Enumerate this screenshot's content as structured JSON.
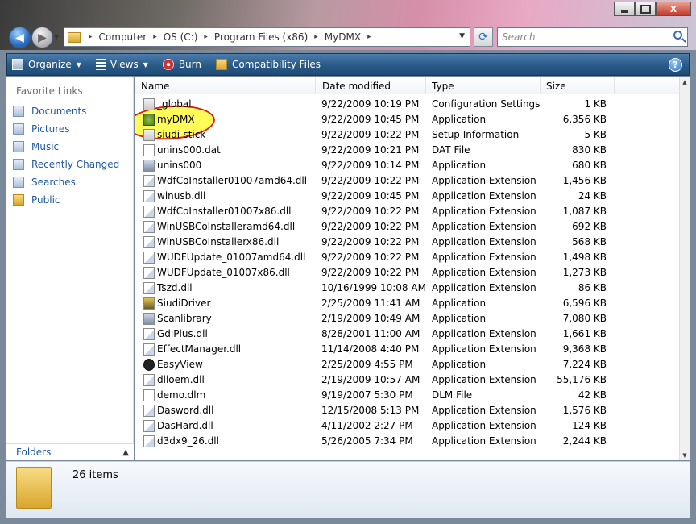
{
  "window": {
    "close_glyph": "X"
  },
  "address_bar": {
    "crumbs": [
      "Computer",
      "OS (C:)",
      "Program Files (x86)",
      "MyDMX"
    ]
  },
  "search": {
    "placeholder": "Search"
  },
  "toolbar": {
    "organize": "Organize",
    "views": "Views",
    "burn": "Burn",
    "compatibility": "Compatibility Files",
    "help": "?"
  },
  "nav_pane": {
    "title": "Favorite Links",
    "items": [
      "Documents",
      "Pictures",
      "Music",
      "Recently Changed",
      "Searches",
      "Public"
    ],
    "folders_label": "Folders"
  },
  "file_list": {
    "columns": [
      "Name",
      "Date modified",
      "Type",
      "Size"
    ],
    "rows": [
      {
        "name": "_global",
        "date": "9/22/2009 10:19 PM",
        "type": "Configuration Settings",
        "size": "1 KB",
        "icon": "settings-file-icon"
      },
      {
        "name": "myDMX",
        "date": "9/22/2009 10:45 PM",
        "type": "Application",
        "size": "6,356 KB",
        "icon": "mydmx-app-icon"
      },
      {
        "name": "siudi-stick",
        "date": "9/22/2009 10:22 PM",
        "type": "Setup Information",
        "size": "5 KB",
        "icon": "setup-info-icon"
      },
      {
        "name": "unins000.dat",
        "date": "9/22/2009 10:21 PM",
        "type": "DAT File",
        "size": "830 KB",
        "icon": "file-icon"
      },
      {
        "name": "unins000",
        "date": "9/22/2009 10:14 PM",
        "type": "Application",
        "size": "680 KB",
        "icon": "app-icon"
      },
      {
        "name": "WdfCoInstaller01007amd64.dll",
        "date": "9/22/2009 10:22 PM",
        "type": "Application Extension",
        "size": "1,456 KB",
        "icon": "dll-icon"
      },
      {
        "name": "winusb.dll",
        "date": "9/22/2009 10:45 PM",
        "type": "Application Extension",
        "size": "24 KB",
        "icon": "dll-icon"
      },
      {
        "name": "WdfCoInstaller01007x86.dll",
        "date": "9/22/2009 10:22 PM",
        "type": "Application Extension",
        "size": "1,087 KB",
        "icon": "dll-icon"
      },
      {
        "name": "WinUSBCoInstalleramd64.dll",
        "date": "9/22/2009 10:22 PM",
        "type": "Application Extension",
        "size": "692 KB",
        "icon": "dll-icon"
      },
      {
        "name": "WinUSBCoInstallerx86.dll",
        "date": "9/22/2009 10:22 PM",
        "type": "Application Extension",
        "size": "568 KB",
        "icon": "dll-icon"
      },
      {
        "name": "WUDFUpdate_01007amd64.dll",
        "date": "9/22/2009 10:22 PM",
        "type": "Application Extension",
        "size": "1,498 KB",
        "icon": "dll-icon"
      },
      {
        "name": "WUDFUpdate_01007x86.dll",
        "date": "9/22/2009 10:22 PM",
        "type": "Application Extension",
        "size": "1,273 KB",
        "icon": "dll-icon"
      },
      {
        "name": "Tszd.dll",
        "date": "10/16/1999 10:08 AM",
        "type": "Application Extension",
        "size": "86 KB",
        "icon": "dll-icon"
      },
      {
        "name": "SiudiDriver",
        "date": "2/25/2009 11:41 AM",
        "type": "Application",
        "size": "6,596 KB",
        "icon": "siudi-driver-icon"
      },
      {
        "name": "Scanlibrary",
        "date": "2/19/2009 10:49 AM",
        "type": "Application",
        "size": "7,080 KB",
        "icon": "app-icon"
      },
      {
        "name": "GdiPlus.dll",
        "date": "8/28/2001 11:00 AM",
        "type": "Application Extension",
        "size": "1,661 KB",
        "icon": "dll-icon"
      },
      {
        "name": "EffectManager.dll",
        "date": "11/14/2008 4:40 PM",
        "type": "Application Extension",
        "size": "9,368 KB",
        "icon": "dll-icon"
      },
      {
        "name": "EasyView",
        "date": "2/25/2009 4:55 PM",
        "type": "Application",
        "size": "7,224 KB",
        "icon": "easyview-icon"
      },
      {
        "name": "dlloem.dll",
        "date": "2/19/2009 10:57 AM",
        "type": "Application Extension",
        "size": "55,176 KB",
        "icon": "dll-icon"
      },
      {
        "name": "demo.dlm",
        "date": "9/19/2007 5:30 PM",
        "type": "DLM File",
        "size": "42 KB",
        "icon": "file-icon"
      },
      {
        "name": "Dasword.dll",
        "date": "12/15/2008 5:13 PM",
        "type": "Application Extension",
        "size": "1,576 KB",
        "icon": "dll-icon"
      },
      {
        "name": "DasHard.dll",
        "date": "4/11/2002 2:27 PM",
        "type": "Application Extension",
        "size": "124 KB",
        "icon": "dll-icon"
      },
      {
        "name": "d3dx9_26.dll",
        "date": "5/26/2005 7:34 PM",
        "type": "Application Extension",
        "size": "2,244 KB",
        "icon": "dll-icon"
      }
    ]
  },
  "details_pane": {
    "item_count": "26 items"
  }
}
